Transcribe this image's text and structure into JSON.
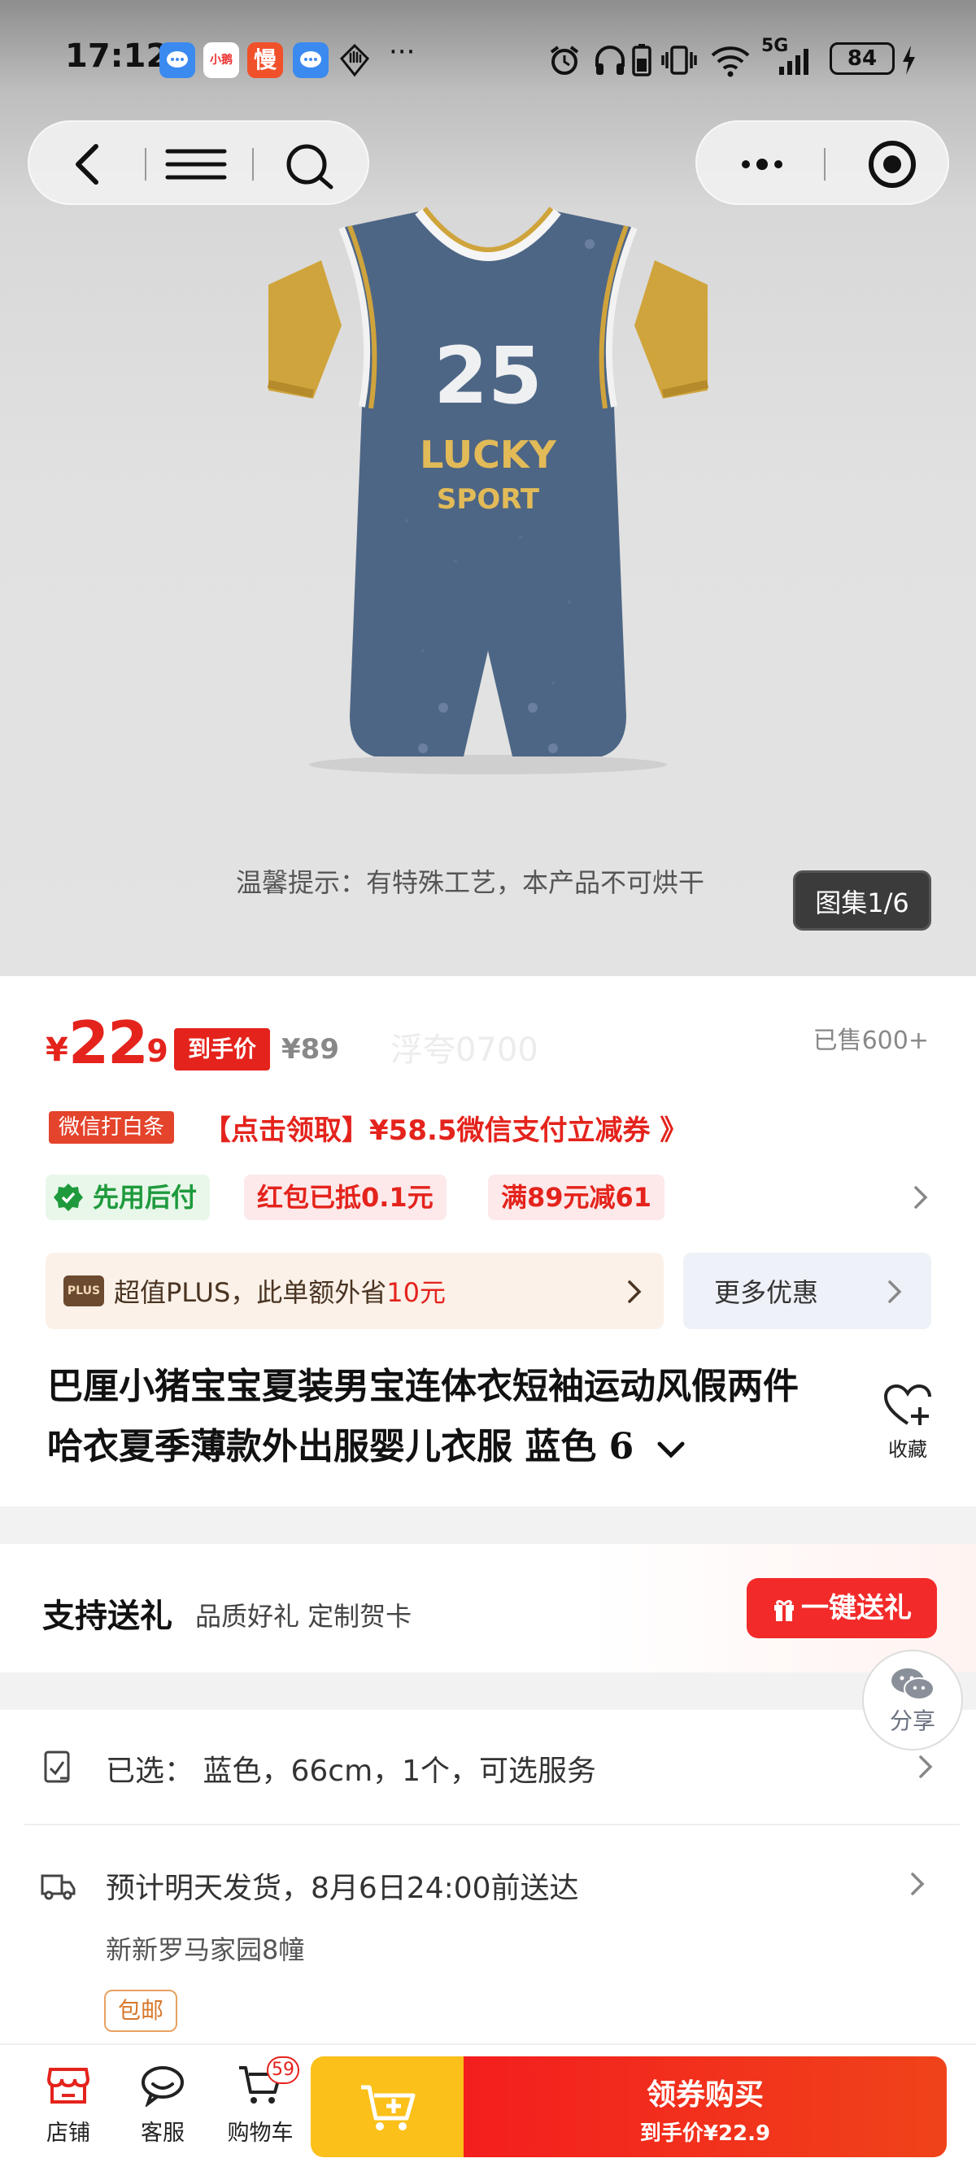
{
  "status_bar": {
    "time": "17:12",
    "notif_icons": [
      "message-icon",
      "xiaohongshu-icon",
      "slow-icon",
      "message-icon",
      "hand-icon"
    ],
    "notif_app2": "小鹅",
    "notif_app3": "慢",
    "more": "···",
    "network": "5G",
    "battery": "84"
  },
  "hero": {
    "tip": "温馨提示：有特殊工艺，本产品不可烘干",
    "gallery": "图集1/6",
    "print_number": "25",
    "print_line1": "LUCKY",
    "print_line2": "SPORT"
  },
  "price": {
    "currency": "¥",
    "integer": "22",
    "decimal": ".9",
    "final_tag": "到手价",
    "original": "¥89",
    "watermark": "浮夸0700",
    "sold": "已售600+"
  },
  "wechat_promo": {
    "tag": "微信打白条",
    "text": "【点击领取】¥58.5微信支付立减券 》"
  },
  "promo_chips": [
    "先用后付",
    "红包已抵0.1元",
    "满89元减61"
  ],
  "plus": {
    "logo": "PLUS",
    "text_before": "超值PLUS，此单额外省",
    "amount": "10元",
    "more_offers": "更多优惠"
  },
  "product_title": "巴厘小猪宝宝夏装男宝连体衣短袖运动风假两件哈衣夏季薄款外出服婴儿衣服 蓝色 6",
  "favorite_label": "收藏",
  "gift": {
    "title": "支持送礼",
    "subtitle": "品质好礼 定制贺卡",
    "button": "一键送礼"
  },
  "share_label": "分享",
  "selected": {
    "prefix": "已选：",
    "value": "蓝色，66cm，1个，可选服务"
  },
  "delivery": {
    "text": "预计明天发货，8月6日24:00前送达",
    "address": "新新罗马家园8幢",
    "free_shipping": "包邮"
  },
  "bottom_bar": {
    "tabs": [
      {
        "label": "店铺"
      },
      {
        "label": "客服"
      },
      {
        "label": "购物车"
      }
    ],
    "cart_count": "59",
    "buy_main": "领券购买",
    "buy_sub": "到手价¥22.9"
  },
  "colors": {
    "accent_red": "#e4231c",
    "cart_yellow": "#fbc01a",
    "plus_bg": "#fbf1e8"
  }
}
